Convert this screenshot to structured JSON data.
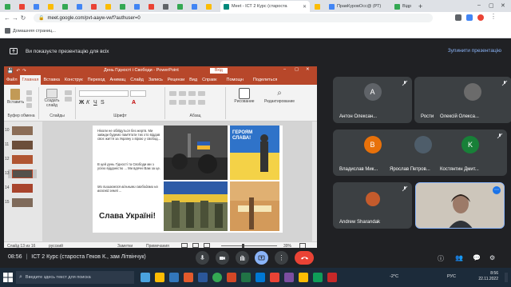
{
  "browser": {
    "tabs": [
      {
        "label": "",
        "color": "#34a853"
      },
      {
        "label": "",
        "color": "#ea4335"
      },
      {
        "label": "",
        "color": "#4285f4"
      },
      {
        "label": "",
        "color": "#fbbc04"
      },
      {
        "label": "Meet - ІСТ 2 Курс (староста",
        "color": "#00897b"
      },
      {
        "label": "",
        "color": "#fbbc04"
      },
      {
        "label": "ПравКуровОсс@ (РТ)",
        "color": "#4285f4"
      },
      {
        "label": "Відр",
        "color": "#34a853"
      }
    ],
    "url": "meet.google.com/pvt-aayw-vwf?authuser=0",
    "bookmark_label": "Домашняя страниц..."
  },
  "banner": {
    "message": "Ви показуєте презентацію для всіх",
    "stop_label": "Зупинити презентацію"
  },
  "ppt": {
    "title": "День Гідності і Свободи - PowerPoint",
    "login": "Вхід",
    "menu": [
      "Файл",
      "Главная",
      "Вставка",
      "Конструк",
      "Переход",
      "Анимац",
      "Слайд",
      "Запись",
      "Рецензи",
      "Вид",
      "Справк",
      "Помощн",
      "Поделиться"
    ],
    "ribbon": {
      "paste": "Вставить",
      "new_slide": "Создать слайд",
      "groups": [
        "Буфер обмена",
        "Слайды",
        "Шрифт",
        "Абзац",
        "Рисование",
        "Редактирование"
      ],
      "drawing": "Рисование",
      "editing": "Редактирование"
    },
    "slide_numbers": [
      "10",
      "11",
      "12",
      "13",
      "14",
      "15"
    ],
    "slide": {
      "bullets": [
        "Ніколи не обійдуться без жертв. Ми завжди будемо пам'ятати тих хто віддав своє життя за Україну з вірою у свобод...",
        "В цей день Гідності та Свободи ми з усією відданістю ... Ми вдячні Вам за це.",
        "Ми пишаємося вільними свободами на власній землі ..."
      ],
      "banner_text": "ГЕРОЯМ СЛАВА!",
      "footer_text": "Слава Україні!"
    },
    "status": {
      "slide_count": "Слайд 13 из 16",
      "language": "русский",
      "notes": "Заметки",
      "comments": "Примечания",
      "zoom": "39%"
    }
  },
  "participants": [
    {
      "name": "Антон Олексан...",
      "initial": "A",
      "color": "#5f6368"
    },
    {
      "name": "Ростислав Анат...",
      "initial": "",
      "color": "#000000"
    },
    {
      "name": "Олексій Олекса...",
      "initial": "",
      "color": "#6b6b6b"
    },
    {
      "name": "Владислав Мик...",
      "initial": "B",
      "color": "#e8710a"
    },
    {
      "name": "Ярослав Петров...",
      "initial": "",
      "color": "#4e5d6a"
    },
    {
      "name": "Костянтин Дмит...",
      "initial": "K",
      "color": "#188038"
    },
    {
      "name": "Andrew Sharandak",
      "initial": "",
      "color": "#3c4043"
    },
    {
      "name": "",
      "initial": "",
      "color": "#c8c2b8"
    }
  ],
  "call": {
    "time": "08:56",
    "meeting_name": "ІСТ 2 Курс (староста Геков К., зам Літвінчук)"
  },
  "taskbar": {
    "search_placeholder": "Введите здесь текст для поиска",
    "temperature": "-2°C",
    "lang": "РУС",
    "clock_time": "8:56",
    "clock_date": "22.11.2022"
  }
}
